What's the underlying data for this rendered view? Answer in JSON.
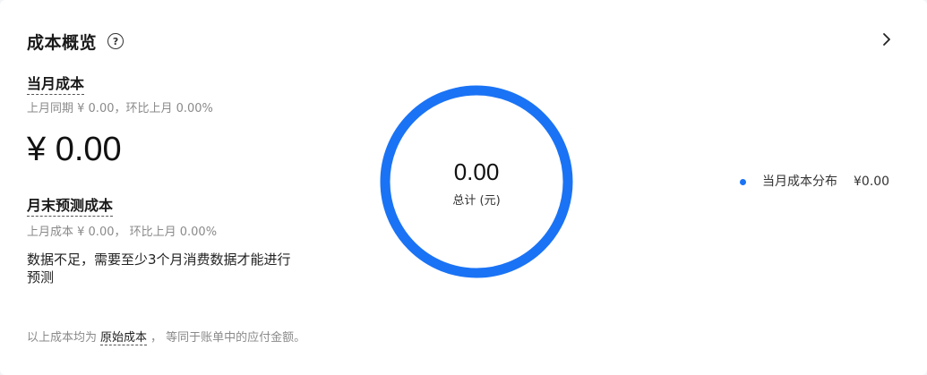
{
  "header": {
    "title": "成本概览",
    "help_glyph": "?"
  },
  "current_month": {
    "label": "当月成本",
    "comparison": "上月同期 ¥ 0.00，环比上月  0.00%",
    "amount": "¥ 0.00"
  },
  "forecast": {
    "label": "月末预测成本",
    "comparison": "上月成本 ¥ 0.00，  环比上月  0.00%",
    "note": "数据不足，需要至少3个月消费数据才能进行预测"
  },
  "footer": {
    "prefix": "以上成本均为",
    "link": "原始成本",
    "suffix": "，  等同于账单中的应付金额。"
  },
  "chart_data": {
    "type": "pie",
    "center_value": "0.00",
    "center_label": "总计 (元)",
    "series": [
      {
        "name": "当月成本分布",
        "value": 0.0,
        "value_label": "¥0.00",
        "color": "#1a73f5"
      }
    ],
    "legend": "right"
  },
  "colors": {
    "accent": "#1a73f5"
  },
  "icons": {
    "help": "question-circle-icon",
    "more": "chevron-right-icon"
  }
}
